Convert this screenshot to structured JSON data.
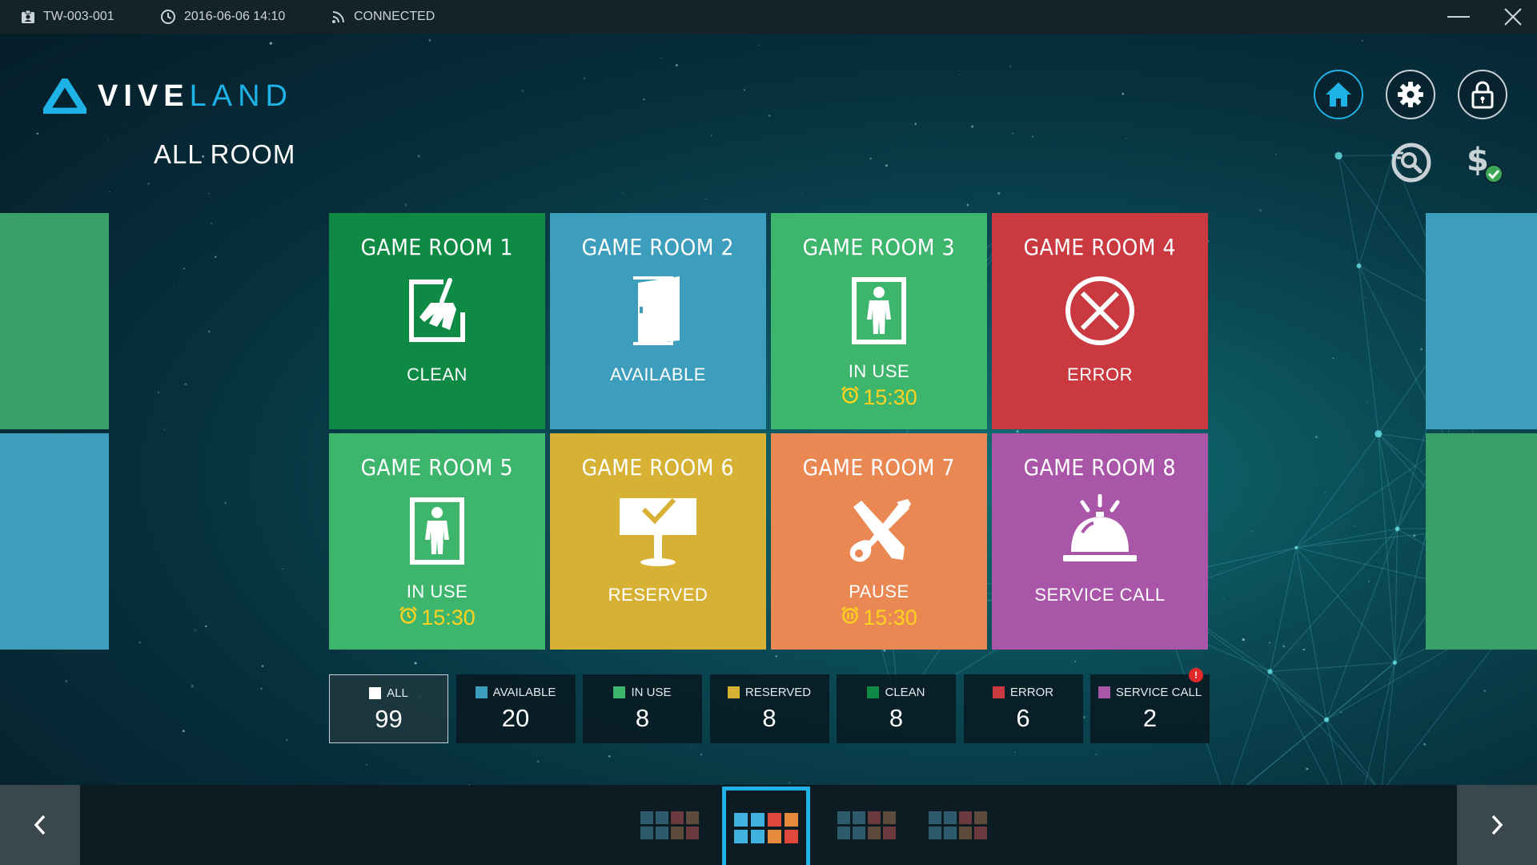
{
  "titlebar": {
    "device_id": "TW-003-001",
    "datetime": "2016-06-06  14:10",
    "connection": "CONNECTED"
  },
  "logo": {
    "part1": "VIVE",
    "part2": "LAND"
  },
  "page_title": "ALL ROOM",
  "header_buttons": [
    {
      "icon": "home-icon",
      "active": true
    },
    {
      "icon": "gear-icon",
      "active": false
    },
    {
      "icon": "lock-icon",
      "active": false
    },
    {
      "icon": "search-room-icon"
    },
    {
      "icon": "payment-check-icon"
    }
  ],
  "rooms": [
    {
      "name": "GAME ROOM 1",
      "status": "CLEAN",
      "color": "#0e8a45",
      "icon": "broom-icon",
      "timer": ""
    },
    {
      "name": "GAME ROOM 2",
      "status": "AVAILABLE",
      "color": "#3d9dbd",
      "icon": "door-icon",
      "timer": ""
    },
    {
      "name": "GAME ROOM 3",
      "status": "IN USE",
      "color": "#3db56c",
      "icon": "person-icon",
      "timer": "15:30",
      "timer_icon": "alarm-clock-icon"
    },
    {
      "name": "GAME ROOM 4",
      "status": "ERROR",
      "color": "#c9393f",
      "icon": "error-icon",
      "timer": ""
    },
    {
      "name": "GAME ROOM 5",
      "status": "IN USE",
      "color": "#3db56c",
      "icon": "person-icon",
      "timer": "15:30",
      "timer_icon": "alarm-clock-icon"
    },
    {
      "name": "GAME ROOM 6",
      "status": "RESERVED",
      "color": "#d7b134",
      "icon": "reserved-sign-icon",
      "timer": ""
    },
    {
      "name": "GAME ROOM 7",
      "status": "PAUSE",
      "color": "#ea8853",
      "icon": "tools-icon",
      "timer": "15:30",
      "timer_icon": "pause-clock-icon"
    },
    {
      "name": "GAME ROOM 8",
      "status": "SERVICE CALL",
      "color": "#a956a8",
      "icon": "service-bell-icon",
      "timer": ""
    }
  ],
  "stats": [
    {
      "label": "ALL",
      "value": "99",
      "color": "#ffffff",
      "selected": true
    },
    {
      "label": "AVAILABLE",
      "value": "20",
      "color": "#3d9dbd"
    },
    {
      "label": "IN USE",
      "value": "8",
      "color": "#3db56c"
    },
    {
      "label": "RESERVED",
      "value": "8",
      "color": "#d7b134"
    },
    {
      "label": "CLEAN",
      "value": "8",
      "color": "#0e8a45"
    },
    {
      "label": "ERROR",
      "value": "6",
      "color": "#c9393f"
    },
    {
      "label": "SERVICE CALL",
      "value": "2",
      "color": "#a956a8",
      "alert": "!"
    }
  ],
  "side_tiles": {
    "left_top_color": "#3aa06a",
    "left_bottom_color": "#3d9dbd",
    "right_top_color": "#3d9dbd",
    "right_bottom_color": "#3aa06a"
  },
  "pagination": {
    "current_page": 2,
    "pages": [
      [
        "#2d5b6b",
        "#2d5b6b",
        "#6b3a3e",
        "#5c4a3a",
        "#2d5b6b",
        "#2d5b6b",
        "#5c4a3a",
        "#6b3a3e"
      ],
      [
        "#3fb2e0",
        "#3fb2e0",
        "#e0483c",
        "#e68a3c",
        "#3fb2e0",
        "#3fb2e0",
        "#e68a3c",
        "#e0483c"
      ],
      [
        "#2d5b6b",
        "#2d5b6b",
        "#6b3a3e",
        "#5c4a3a",
        "#2d5b6b",
        "#2d5b6b",
        "#5c4a3a",
        "#6b3a3e"
      ],
      [
        "#2d5b6b",
        "#2d5b6b",
        "#6b3a3e",
        "#5c4a3a",
        "#2d5b6b",
        "#2d5b6b",
        "#5c4a3a",
        "#6b3a3e"
      ]
    ]
  },
  "nav": {
    "prev_icon": "chevron-left-icon",
    "next_icon": "chevron-right-icon"
  }
}
